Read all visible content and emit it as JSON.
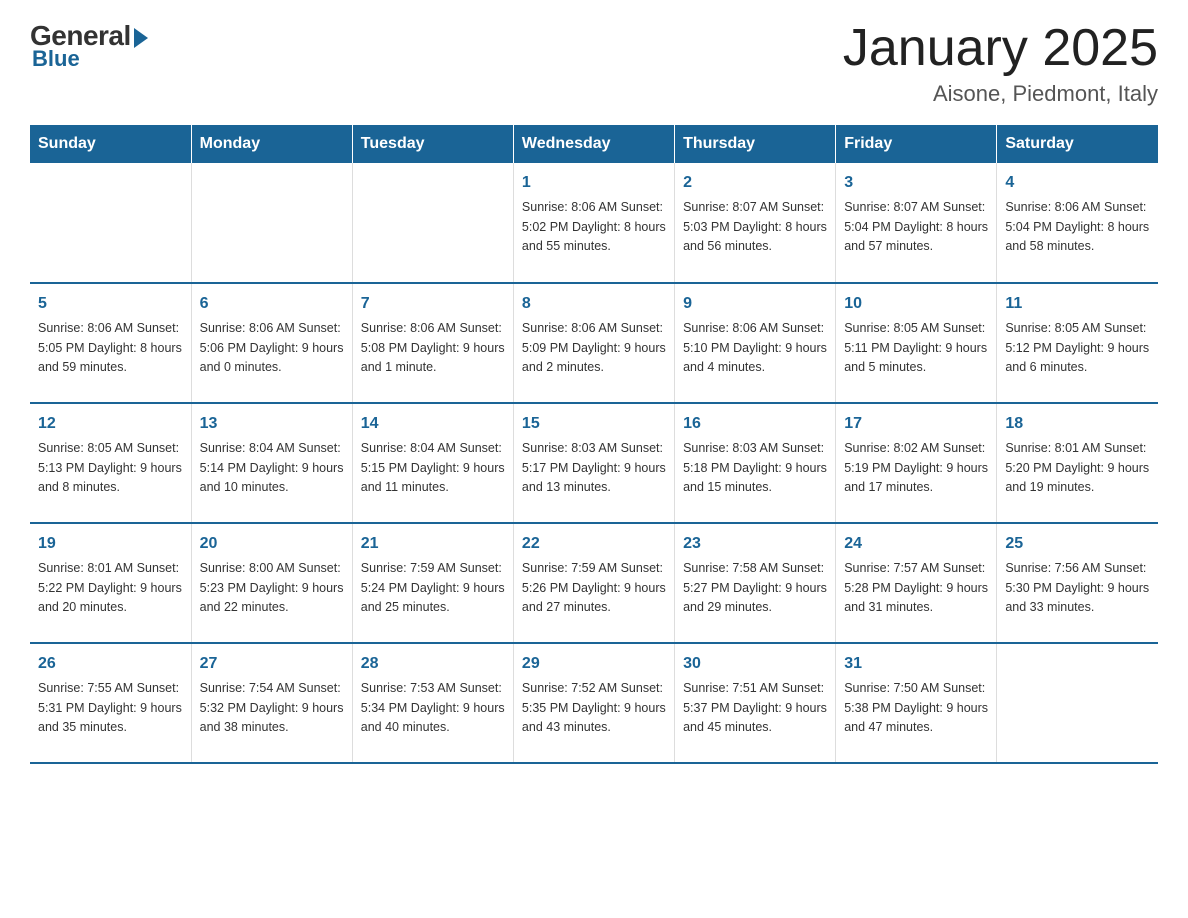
{
  "logo": {
    "general": "General",
    "blue": "Blue",
    "arrow_color": "#1a6496"
  },
  "title": "January 2025",
  "subtitle": "Aisone, Piedmont, Italy",
  "header_days": [
    "Sunday",
    "Monday",
    "Tuesday",
    "Wednesday",
    "Thursday",
    "Friday",
    "Saturday"
  ],
  "weeks": [
    [
      {
        "day": "",
        "info": ""
      },
      {
        "day": "",
        "info": ""
      },
      {
        "day": "",
        "info": ""
      },
      {
        "day": "1",
        "info": "Sunrise: 8:06 AM\nSunset: 5:02 PM\nDaylight: 8 hours\nand 55 minutes."
      },
      {
        "day": "2",
        "info": "Sunrise: 8:07 AM\nSunset: 5:03 PM\nDaylight: 8 hours\nand 56 minutes."
      },
      {
        "day": "3",
        "info": "Sunrise: 8:07 AM\nSunset: 5:04 PM\nDaylight: 8 hours\nand 57 minutes."
      },
      {
        "day": "4",
        "info": "Sunrise: 8:06 AM\nSunset: 5:04 PM\nDaylight: 8 hours\nand 58 minutes."
      }
    ],
    [
      {
        "day": "5",
        "info": "Sunrise: 8:06 AM\nSunset: 5:05 PM\nDaylight: 8 hours\nand 59 minutes."
      },
      {
        "day": "6",
        "info": "Sunrise: 8:06 AM\nSunset: 5:06 PM\nDaylight: 9 hours\nand 0 minutes."
      },
      {
        "day": "7",
        "info": "Sunrise: 8:06 AM\nSunset: 5:08 PM\nDaylight: 9 hours\nand 1 minute."
      },
      {
        "day": "8",
        "info": "Sunrise: 8:06 AM\nSunset: 5:09 PM\nDaylight: 9 hours\nand 2 minutes."
      },
      {
        "day": "9",
        "info": "Sunrise: 8:06 AM\nSunset: 5:10 PM\nDaylight: 9 hours\nand 4 minutes."
      },
      {
        "day": "10",
        "info": "Sunrise: 8:05 AM\nSunset: 5:11 PM\nDaylight: 9 hours\nand 5 minutes."
      },
      {
        "day": "11",
        "info": "Sunrise: 8:05 AM\nSunset: 5:12 PM\nDaylight: 9 hours\nand 6 minutes."
      }
    ],
    [
      {
        "day": "12",
        "info": "Sunrise: 8:05 AM\nSunset: 5:13 PM\nDaylight: 9 hours\nand 8 minutes."
      },
      {
        "day": "13",
        "info": "Sunrise: 8:04 AM\nSunset: 5:14 PM\nDaylight: 9 hours\nand 10 minutes."
      },
      {
        "day": "14",
        "info": "Sunrise: 8:04 AM\nSunset: 5:15 PM\nDaylight: 9 hours\nand 11 minutes."
      },
      {
        "day": "15",
        "info": "Sunrise: 8:03 AM\nSunset: 5:17 PM\nDaylight: 9 hours\nand 13 minutes."
      },
      {
        "day": "16",
        "info": "Sunrise: 8:03 AM\nSunset: 5:18 PM\nDaylight: 9 hours\nand 15 minutes."
      },
      {
        "day": "17",
        "info": "Sunrise: 8:02 AM\nSunset: 5:19 PM\nDaylight: 9 hours\nand 17 minutes."
      },
      {
        "day": "18",
        "info": "Sunrise: 8:01 AM\nSunset: 5:20 PM\nDaylight: 9 hours\nand 19 minutes."
      }
    ],
    [
      {
        "day": "19",
        "info": "Sunrise: 8:01 AM\nSunset: 5:22 PM\nDaylight: 9 hours\nand 20 minutes."
      },
      {
        "day": "20",
        "info": "Sunrise: 8:00 AM\nSunset: 5:23 PM\nDaylight: 9 hours\nand 22 minutes."
      },
      {
        "day": "21",
        "info": "Sunrise: 7:59 AM\nSunset: 5:24 PM\nDaylight: 9 hours\nand 25 minutes."
      },
      {
        "day": "22",
        "info": "Sunrise: 7:59 AM\nSunset: 5:26 PM\nDaylight: 9 hours\nand 27 minutes."
      },
      {
        "day": "23",
        "info": "Sunrise: 7:58 AM\nSunset: 5:27 PM\nDaylight: 9 hours\nand 29 minutes."
      },
      {
        "day": "24",
        "info": "Sunrise: 7:57 AM\nSunset: 5:28 PM\nDaylight: 9 hours\nand 31 minutes."
      },
      {
        "day": "25",
        "info": "Sunrise: 7:56 AM\nSunset: 5:30 PM\nDaylight: 9 hours\nand 33 minutes."
      }
    ],
    [
      {
        "day": "26",
        "info": "Sunrise: 7:55 AM\nSunset: 5:31 PM\nDaylight: 9 hours\nand 35 minutes."
      },
      {
        "day": "27",
        "info": "Sunrise: 7:54 AM\nSunset: 5:32 PM\nDaylight: 9 hours\nand 38 minutes."
      },
      {
        "day": "28",
        "info": "Sunrise: 7:53 AM\nSunset: 5:34 PM\nDaylight: 9 hours\nand 40 minutes."
      },
      {
        "day": "29",
        "info": "Sunrise: 7:52 AM\nSunset: 5:35 PM\nDaylight: 9 hours\nand 43 minutes."
      },
      {
        "day": "30",
        "info": "Sunrise: 7:51 AM\nSunset: 5:37 PM\nDaylight: 9 hours\nand 45 minutes."
      },
      {
        "day": "31",
        "info": "Sunrise: 7:50 AM\nSunset: 5:38 PM\nDaylight: 9 hours\nand 47 minutes."
      },
      {
        "day": "",
        "info": ""
      }
    ]
  ]
}
